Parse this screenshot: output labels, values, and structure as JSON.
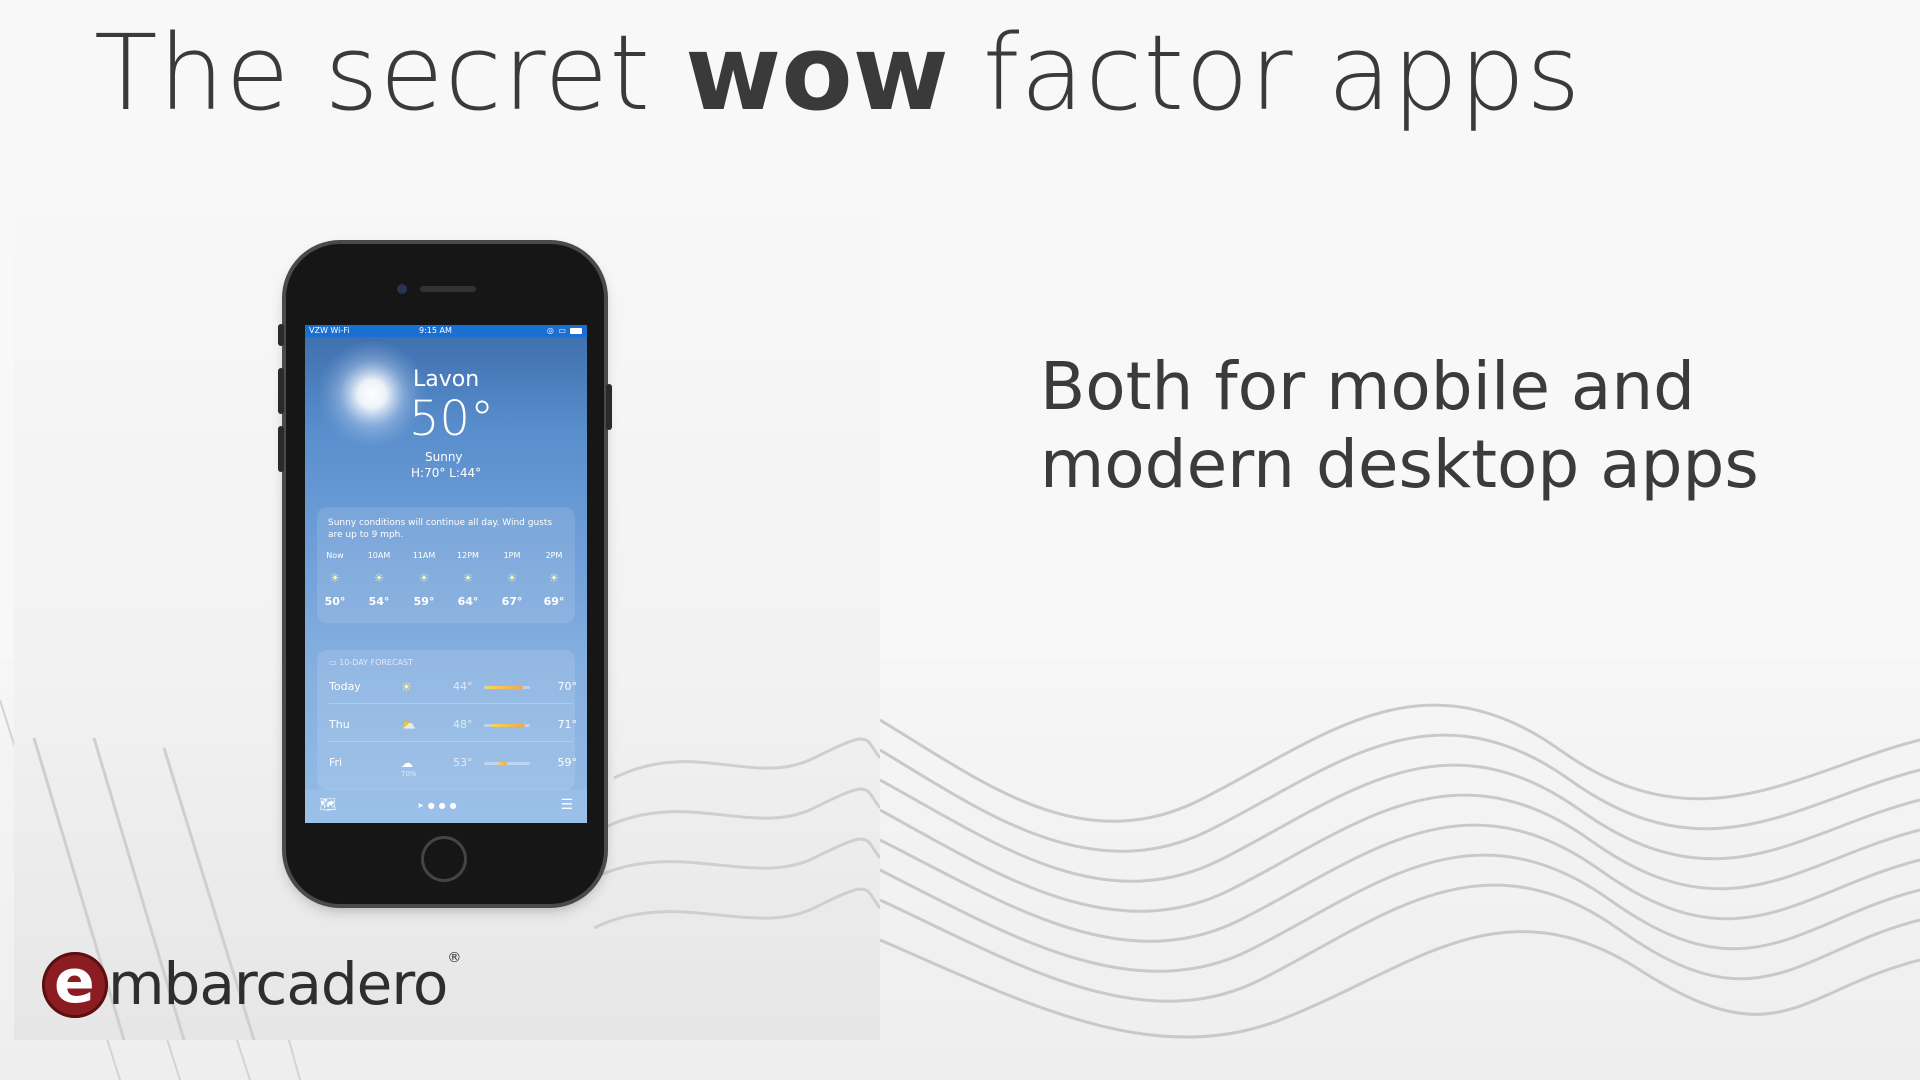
{
  "title": {
    "prefix": "The secret ",
    "emphasis": "wow",
    "suffix": " factor apps"
  },
  "subtitle": {
    "line1": "Both for mobile and",
    "line2": "modern desktop apps"
  },
  "logo": {
    "e": "e",
    "text": "mbarcadero",
    "reg": "®",
    "color": "#8b1d22"
  },
  "phone": {
    "status": {
      "carrier": "VZW Wi-Fi",
      "time": "9:15 AM"
    },
    "weather": {
      "city": "Lavon",
      "temp": "50°",
      "condition": "Sunny",
      "hilo": "H:70°  L:44°",
      "summary": "Sunny conditions will continue all day. Wind gusts are up to 9 mph.",
      "hourly": [
        {
          "label": "Now",
          "temp": "50°"
        },
        {
          "label": "10AM",
          "temp": "54°"
        },
        {
          "label": "11AM",
          "temp": "59°"
        },
        {
          "label": "12PM",
          "temp": "64°"
        },
        {
          "label": "1PM",
          "temp": "67°"
        },
        {
          "label": "2PM",
          "temp": "69°"
        }
      ],
      "forecast_title": "10-DAY FORECAST",
      "forecast": [
        {
          "day": "Today",
          "icon": "sun-icon",
          "pct": "",
          "low": "44°",
          "high": "70°",
          "range": [
            0.05,
            0.85
          ]
        },
        {
          "day": "Thu",
          "icon": "partly-cloudy-icon",
          "pct": "",
          "low": "48°",
          "high": "71°",
          "range": [
            0.15,
            0.9
          ]
        },
        {
          "day": "Fri",
          "icon": "cloud-icon",
          "pct": "70%",
          "low": "53°",
          "high": "59°",
          "range": [
            0.3,
            0.5
          ]
        }
      ]
    }
  }
}
